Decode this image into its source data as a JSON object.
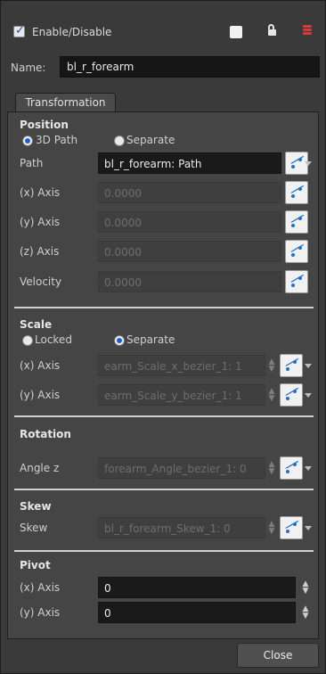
{
  "header": {
    "enable_label": "Enable/Disable",
    "enabled": true,
    "icons": [
      "color-swatch-icon",
      "lock-icon",
      "layers-icon"
    ]
  },
  "name": {
    "label": "Name:",
    "value": "bl_r_forearm"
  },
  "tabs": [
    {
      "label": "Transformation"
    }
  ],
  "position": {
    "title": "Position",
    "mode_3d": "3D Path",
    "mode_separate": "Separate",
    "selected": "3D Path",
    "path": {
      "label": "Path",
      "value": "bl_r_forearm: Path"
    },
    "x": {
      "label": "(x) Axis",
      "value": "0.0000"
    },
    "y": {
      "label": "(y) Axis",
      "value": "0.0000"
    },
    "z": {
      "label": "(z) Axis",
      "value": "0.0000"
    },
    "velocity": {
      "label": "Velocity",
      "value": "0.0000"
    }
  },
  "scale": {
    "title": "Scale",
    "mode_locked": "Locked",
    "mode_separate": "Separate",
    "selected": "Separate",
    "x": {
      "label": "(x) Axis",
      "value": "earm_Scale_x_bezier_1: 1"
    },
    "y": {
      "label": "(y) Axis",
      "value": "earm_Scale_y_bezier_1: 1"
    }
  },
  "rotation": {
    "title": "Rotation",
    "angle_z": {
      "label": "Angle z",
      "value": "forearm_Angle_bezier_1: 0"
    }
  },
  "skew": {
    "title": "Skew",
    "skew": {
      "label": "Skew",
      "value": "bl_r_forearm_Skew_1: 0"
    }
  },
  "pivot": {
    "title": "Pivot",
    "x": {
      "label": "(x) Axis",
      "value": "0"
    },
    "y": {
      "label": "(y) Axis",
      "value": "0"
    }
  },
  "footer": {
    "close_label": "Close"
  },
  "colors": {
    "background": "#3a3a3a",
    "panel": "#454545",
    "field_active": "#1a1a1a",
    "accent_blue": "#1f6fd1",
    "layers_red": "#d63a3a"
  }
}
